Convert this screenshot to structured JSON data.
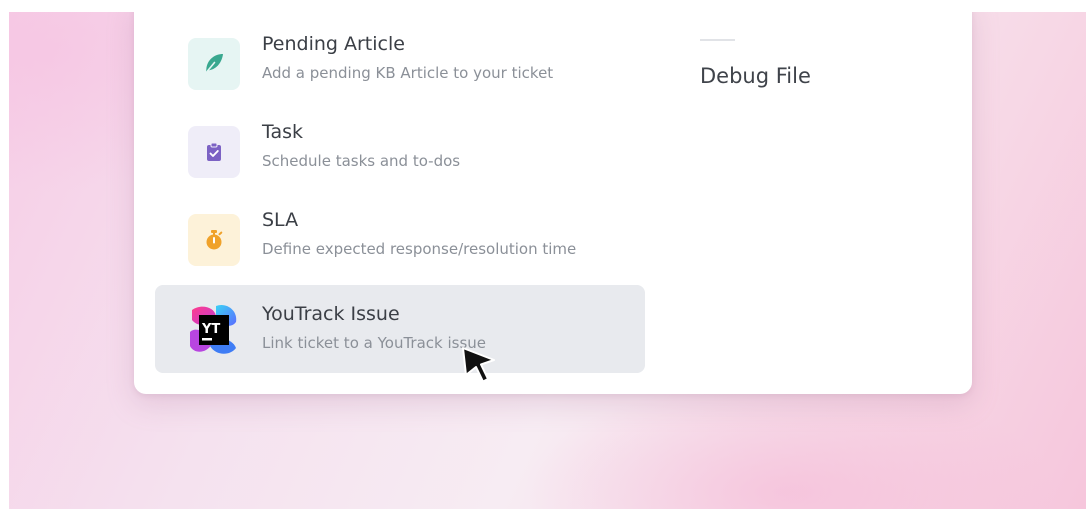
{
  "menu": {
    "items": [
      {
        "title": "Pending Article",
        "description": "Add a pending KB Article to your ticket",
        "icon": "feather-icon",
        "tile_color": "#e6f5f3",
        "icon_color": "#39a88f"
      },
      {
        "title": "Task",
        "description": "Schedule tasks and to-dos",
        "icon": "clipboard-check-icon",
        "tile_color": "#efedf8",
        "icon_color": "#7c62c4"
      },
      {
        "title": "SLA",
        "description": "Define expected response/resolution time",
        "icon": "stopwatch-icon",
        "tile_color": "#fdf2d9",
        "icon_color": "#f0a22a"
      },
      {
        "title": "YouTrack Issue",
        "description": "Link ticket to a YouTrack issue",
        "icon": "youtrack-logo-icon",
        "logo_text": "YT",
        "hovered": true
      }
    ]
  },
  "side": {
    "label": "Debug File"
  },
  "colors": {
    "hover_background": "#e8eaee",
    "title_text": "#3b3f46",
    "description_text": "#8b9098"
  }
}
